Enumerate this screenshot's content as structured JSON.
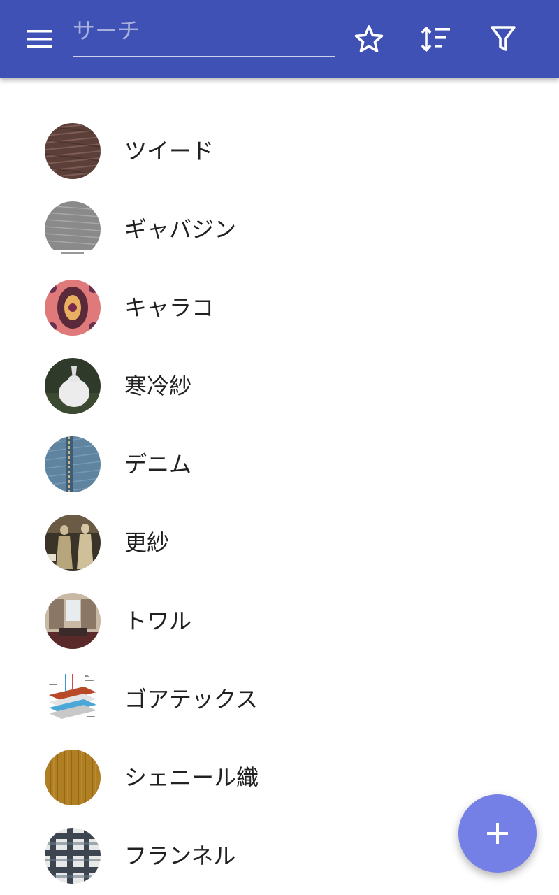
{
  "appbar": {
    "color": "#3f51b5",
    "menu_icon": "menu-icon",
    "search": {
      "placeholder": "サーチ",
      "value": ""
    },
    "actions": [
      {
        "name": "favorites",
        "icon": "star-outline-icon"
      },
      {
        "name": "sort",
        "icon": "sort-icon"
      },
      {
        "name": "filter",
        "icon": "filter-icon"
      }
    ]
  },
  "items": [
    {
      "label": "ツイード",
      "thumb": "tweed-thumbnail"
    },
    {
      "label": "ギャバジン",
      "thumb": "gabardine-thumbnail"
    },
    {
      "label": "キャラコ",
      "thumb": "calico-thumbnail"
    },
    {
      "label": "寒冷紗",
      "thumb": "cheesecloth-thumbnail"
    },
    {
      "label": "デニム",
      "thumb": "denim-thumbnail"
    },
    {
      "label": "更紗",
      "thumb": "chintz-thumbnail"
    },
    {
      "label": "トワル",
      "thumb": "toile-thumbnail"
    },
    {
      "label": "ゴアテックス",
      "thumb": "gore-tex-thumbnail"
    },
    {
      "label": "シェニール織",
      "thumb": "chenille-thumbnail"
    },
    {
      "label": "フランネル",
      "thumb": "flannel-thumbnail"
    }
  ],
  "fab": {
    "icon": "plus-icon",
    "color": "#7580e6"
  }
}
